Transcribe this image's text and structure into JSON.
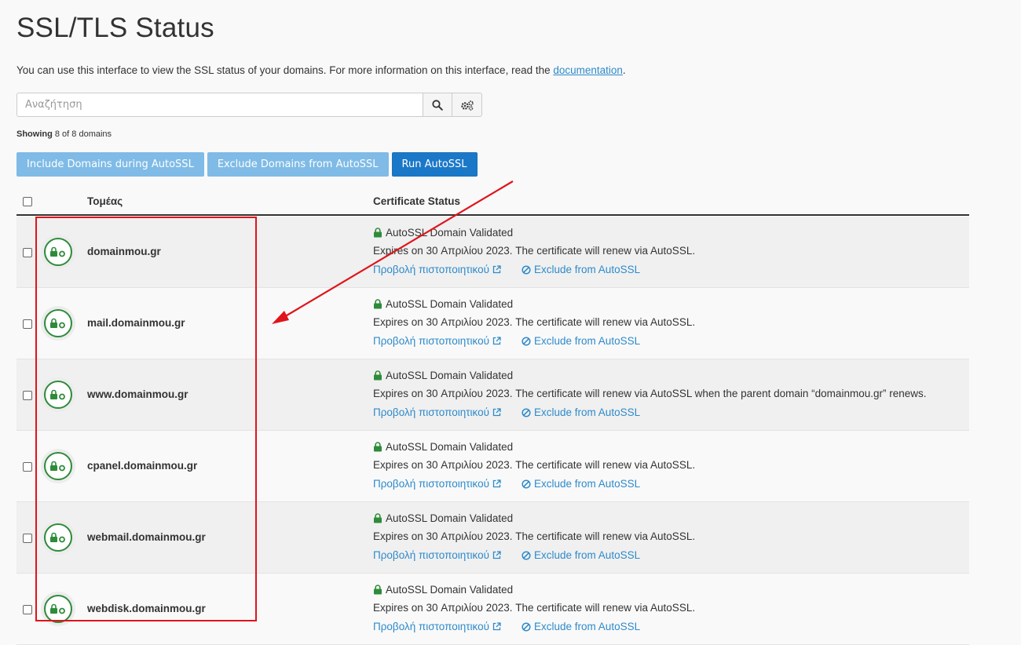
{
  "page": {
    "title": "SSL/TLS Status",
    "description_prefix": "You can use this interface to view the SSL status of your domains. For more information on this interface, read the ",
    "description_link": "documentation",
    "description_suffix": "."
  },
  "search": {
    "placeholder": "Αναζήτηση",
    "search_icon": "search-icon",
    "settings_icon": "gears-icon"
  },
  "showing": {
    "label": "Showing",
    "text": " 8 of 8 domains"
  },
  "actions": {
    "include": "Include Domains during AutoSSL",
    "exclude": "Exclude Domains from AutoSSL",
    "run": "Run AutoSSL"
  },
  "table": {
    "col_domain": "Τομέας",
    "col_status": "Certificate Status",
    "rows": [
      {
        "domain": "domainmou.gr",
        "status": "AutoSSL Domain Validated",
        "expires": "Expires on 30 Απριλίου 2023. The certificate will renew via AutoSSL.",
        "view_cert": "Προβολή πιστοποιητικού",
        "exclude": "Exclude from AutoSSL"
      },
      {
        "domain": "mail.domainmou.gr",
        "status": "AutoSSL Domain Validated",
        "expires": "Expires on 30 Απριλίου 2023. The certificate will renew via AutoSSL.",
        "view_cert": "Προβολή πιστοποιητικού",
        "exclude": "Exclude from AutoSSL"
      },
      {
        "domain": "www.domainmou.gr",
        "status": "AutoSSL Domain Validated",
        "expires": "Expires on 30 Απριλίου 2023. The certificate will renew via AutoSSL when the parent domain “domainmou.gr” renews.",
        "view_cert": "Προβολή πιστοποιητικού",
        "exclude": "Exclude from AutoSSL"
      },
      {
        "domain": "cpanel.domainmou.gr",
        "status": "AutoSSL Domain Validated",
        "expires": "Expires on 30 Απριλίου 2023. The certificate will renew via AutoSSL.",
        "view_cert": "Προβολή πιστοποιητικού",
        "exclude": "Exclude from AutoSSL"
      },
      {
        "domain": "webmail.domainmou.gr",
        "status": "AutoSSL Domain Validated",
        "expires": "Expires on 30 Απριλίου 2023. The certificate will renew via AutoSSL.",
        "view_cert": "Προβολή πιστοποιητικού",
        "exclude": "Exclude from AutoSSL"
      },
      {
        "domain": "webdisk.domainmou.gr",
        "status": "AutoSSL Domain Validated",
        "expires": "Expires on 30 Απριλίου 2023. The certificate will renew via AutoSSL.",
        "view_cert": "Προβολή πιστοποιητικού",
        "exclude": "Exclude from AutoSSL"
      }
    ]
  },
  "colors": {
    "link": "#2d8acb",
    "valid_green": "#2e8b3a",
    "primary_button": "#1b78c8",
    "light_button": "#7fbbe6",
    "annotation_red": "#e0141b"
  }
}
